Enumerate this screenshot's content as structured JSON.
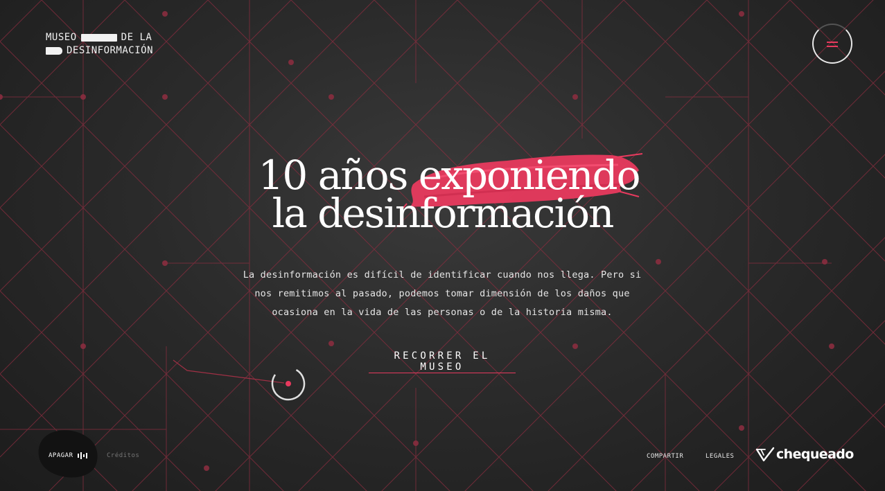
{
  "logo": {
    "line1_start": "MUSEO",
    "line1_end": "DE LA",
    "line2": "DESINFORMACIÓN"
  },
  "menu": {
    "icon": "menu-icon"
  },
  "hero": {
    "line1_plain": "10 años",
    "line1_highlight": "exponiendo",
    "line2": "la desinformación"
  },
  "description": "La desinformación es difícil de identificar cuando nos llega.  Pero si nos remitimos al pasado, podemos tomar dimensión  de los daños que ocasiona en la vida de las personas o de la  historia misma.",
  "cta": {
    "label": "RECORRER EL MUSEO"
  },
  "footer": {
    "sound_label": "APAGAR",
    "sound_icon": "sound-wave-icon",
    "credits_label": "Créditos",
    "share_label": "COMPARTIR",
    "legal_label": "LEGALES",
    "brand_name": "chequeado",
    "brand_icon": "chequeado-check-icon"
  },
  "colors": {
    "accent": "#e83a5e",
    "background": "#2b2b2b",
    "text": "#ffffff"
  }
}
